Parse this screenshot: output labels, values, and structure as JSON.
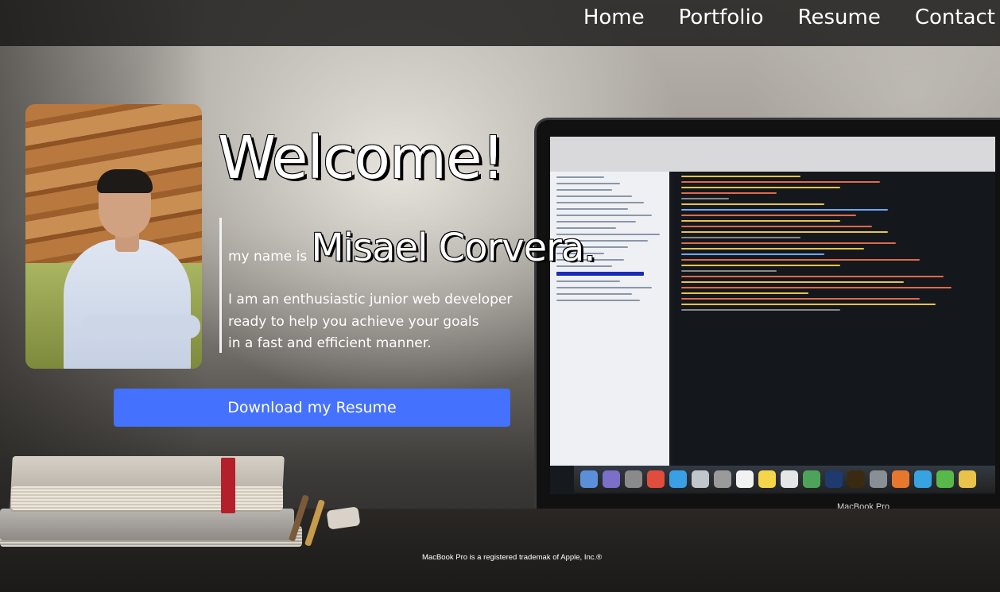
{
  "nav": {
    "links": [
      "Home",
      "Portfolio",
      "Resume",
      "Contact"
    ]
  },
  "hero": {
    "heading": "Welcome!",
    "name_prefix": "my name is",
    "name": "Misael Corvera.",
    "bio_lines": [
      "I am an enthusiastic junior web developer",
      "ready to help you achieve your goals",
      "in a fast and efficient manner."
    ],
    "download_button": "Download my Resume"
  },
  "background": {
    "laptop_label": "MacBook Pro"
  },
  "footer": {
    "note": "MacBook Pro is a registered trademak of Apple, Inc.®"
  },
  "colors": {
    "button": "#4571ff",
    "navbar": "#181716",
    "text": "#ffffff"
  },
  "icons": [
    "profile-photo"
  ]
}
